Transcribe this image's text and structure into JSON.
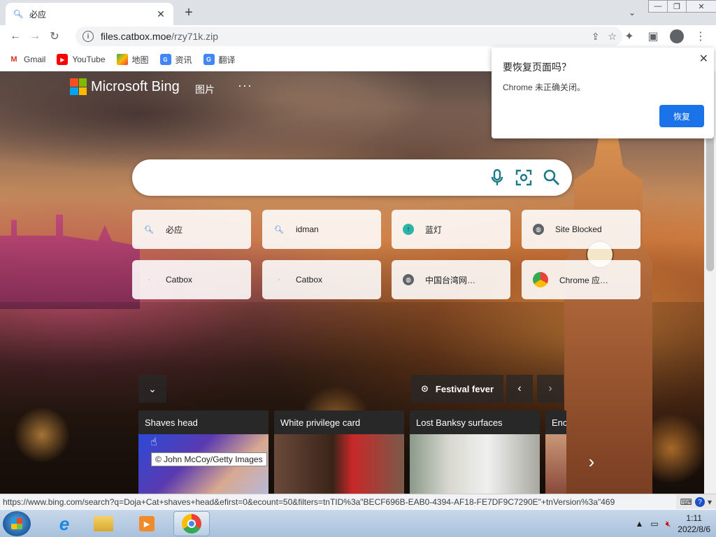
{
  "tab": {
    "title": "必应",
    "favicon": "search-icon"
  },
  "window": {
    "minimize": "—",
    "restore": "❐",
    "close": "✕"
  },
  "address": {
    "host": "files.catbox.moe",
    "path": "/rzy71k.zip"
  },
  "bookmarks": [
    {
      "label": "Gmail",
      "icon": "gmail-icon"
    },
    {
      "label": "YouTube",
      "icon": "youtube-icon"
    },
    {
      "label": "地图",
      "icon": "maps-icon"
    },
    {
      "label": "资讯",
      "icon": "news-icon"
    },
    {
      "label": "翻译",
      "icon": "translate-icon"
    }
  ],
  "bing": {
    "brand": "Microsoft Bing",
    "nav_images": "图片",
    "nav_more": "···"
  },
  "tiles": [
    {
      "label": "必应",
      "icon": "search-icon"
    },
    {
      "label": "idman",
      "icon": "search-icon"
    },
    {
      "label": "蓝灯",
      "icon": "lantern-icon"
    },
    {
      "label": "Site Blocked",
      "icon": "globe-icon"
    },
    {
      "label": "Catbox",
      "icon": "catbox-icon"
    },
    {
      "label": "Catbox",
      "icon": "catbox-icon"
    },
    {
      "label": "中国台湾网…",
      "icon": "globe-icon"
    },
    {
      "label": "Chrome 应…",
      "icon": "chrome-icon"
    }
  ],
  "news": {
    "topic": "Festival fever",
    "cards": [
      {
        "caption": "Shaves head"
      },
      {
        "caption": "White privilege card"
      },
      {
        "caption": "Lost Banksy surfaces"
      },
      {
        "caption": "Enc"
      }
    ],
    "tooltip": "© John McCoy/Getty Images"
  },
  "popup": {
    "title": "要恢复页面吗？",
    "message": "Chrome 未正确关闭。",
    "button": "恢复"
  },
  "status_url": "https://www.bing.com/search?q=Doja+Cat+shaves+head&efirst=0&ecount=50&filters=tnTID%3a\"BECF696B-EAB0-4394-AF18-FE7DF9C7290E\"+tnVersion%3a\"469",
  "clock": {
    "time": "1:11",
    "date": "2022/8/6"
  },
  "colors": {
    "accent": "#1a73e8",
    "search_icon": "#1a7a8a"
  }
}
